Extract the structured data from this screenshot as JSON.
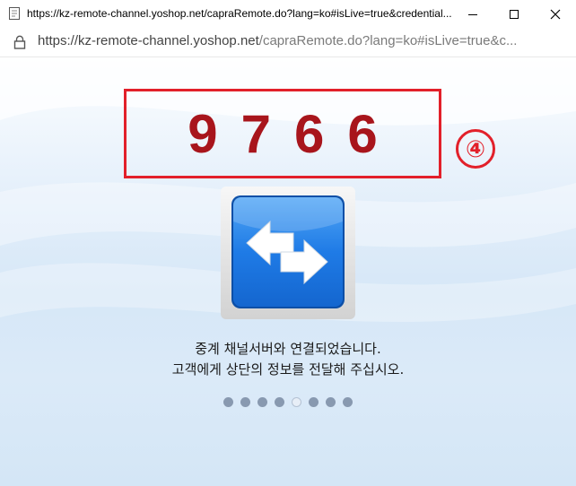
{
  "window": {
    "title": "https://kz-remote-channel.yoshop.net/capraRemote.do?lang=ko#isLive=true&credential...",
    "minimize_icon": "minimize-icon",
    "maximize_icon": "maximize-icon",
    "close_icon": "close-icon"
  },
  "address": {
    "host": "https://kz-remote-channel.yoshop.net",
    "path": "/capraRemote.do?lang=ko#isLive=true&c...",
    "lock_icon": "lock-icon"
  },
  "content": {
    "code": "9766",
    "marker": "④",
    "connect_icon": "connection-arrows-icon",
    "message_line1": "중계 채널서버와 연결되었습니다.",
    "message_line2": "고객에게 상단의 정보를 전달해 주십시오."
  },
  "progress": {
    "dots": 8,
    "active_index": 4
  },
  "colors": {
    "code_text": "#a8151c",
    "highlight_border": "#e2202a",
    "icon_blue": "#1f7be6",
    "dot": "#8899b0"
  }
}
